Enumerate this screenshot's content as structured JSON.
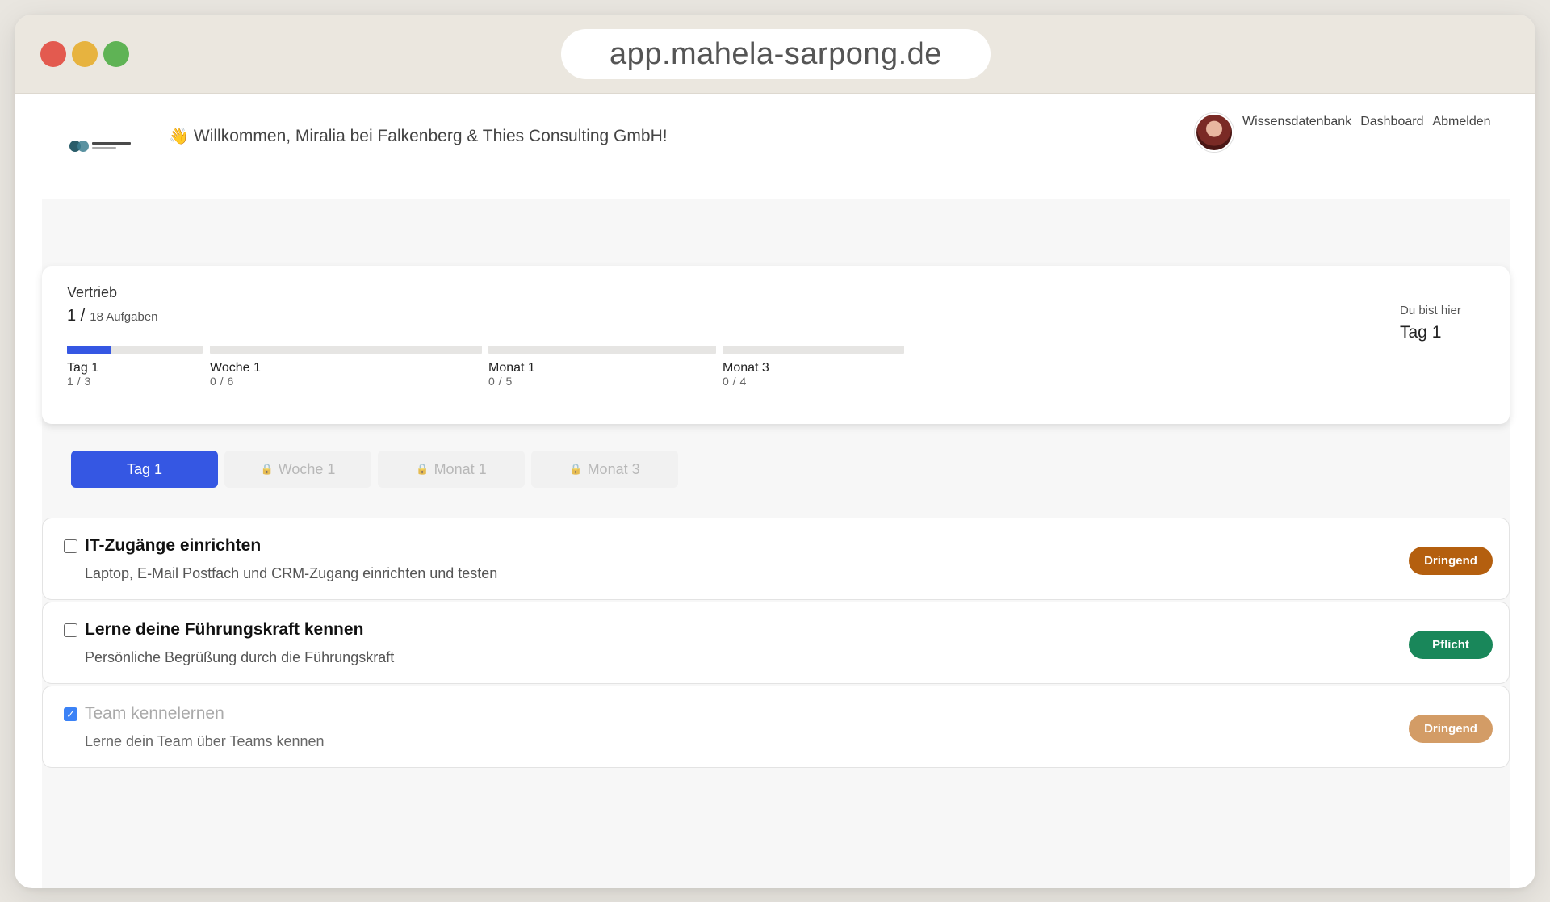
{
  "browser": {
    "url": "app.mahela-sarpong.de"
  },
  "header": {
    "wave_emoji": "👋",
    "welcome": "Willkommen, Miralia bei Falkenberg & Thies Consulting GmbH!",
    "nav": [
      "Wissensdatenbank",
      "Dashboard",
      "Abmelden"
    ]
  },
  "progress": {
    "department": "Vertrieb",
    "done": "1 /",
    "total": "18 Aufgaben",
    "here_label": "Du bist hier",
    "here_value": "Tag 1",
    "phases": [
      {
        "label": "Tag 1",
        "count": "1 / 3",
        "fraction": 0.333
      },
      {
        "label": "Woche 1",
        "count": "0 / 6",
        "fraction": 0
      },
      {
        "label": "Monat 1",
        "count": "0 / 5",
        "fraction": 0
      },
      {
        "label": "Monat 3",
        "count": "0 / 4",
        "fraction": 0
      }
    ]
  },
  "tabs": [
    {
      "label": "Tag 1",
      "locked": false
    },
    {
      "label": "Woche 1",
      "locked": true
    },
    {
      "label": "Monat 1",
      "locked": true
    },
    {
      "label": "Monat 3",
      "locked": true
    }
  ],
  "tasks": [
    {
      "title": "IT-Zugänge einrichten",
      "desc": "Laptop, E-Mail Postfach und CRM-Zugang einrichten und testen",
      "badge": "Dringend",
      "badge_color": "#b45f0f",
      "checked": false
    },
    {
      "title": "Lerne deine Führungskraft kennen",
      "desc": "Persönliche Begrüßung durch die Führungskraft",
      "badge": "Pflicht",
      "badge_color": "#19875a",
      "checked": false
    },
    {
      "title": "Team kennelernen",
      "desc": "Lerne dein Team über Teams kennen",
      "badge": "Dringend",
      "badge_color": "#d39c66",
      "checked": true
    }
  ],
  "colors": {
    "accent": "#3557e3"
  }
}
